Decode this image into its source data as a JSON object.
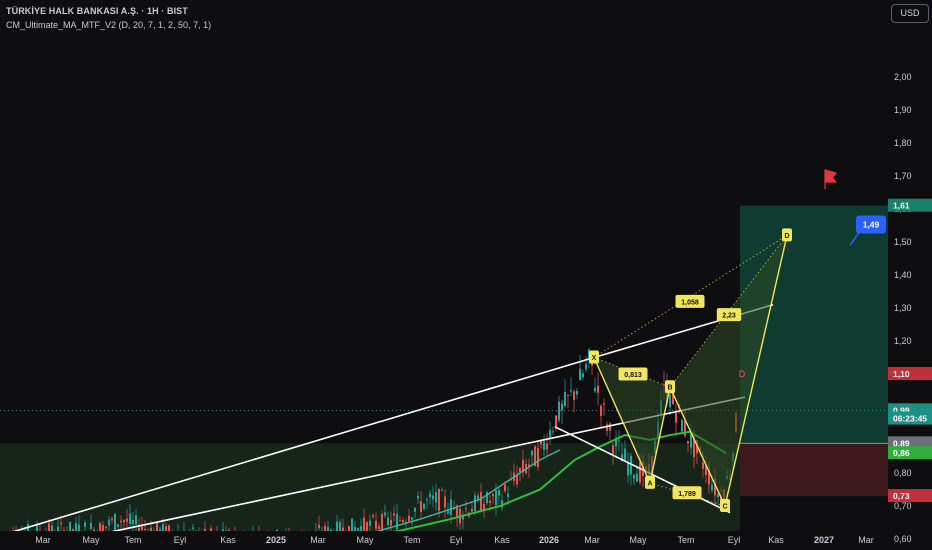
{
  "header": {
    "title": "TÜRKİYE HALK BANKASI A.Ş. · 1H · BIST",
    "indicator": "CM_Ultimate_MA_MTF_V2 (D, 20, 7, 1, 2, 50, 7, 1)",
    "currency": "USD"
  },
  "colors": {
    "background": "#0e0e10",
    "up": "#26a69a",
    "down": "#ef5350",
    "ma": "#2fbf3a",
    "pattern": "#f2e65a",
    "channel": "#ffffff",
    "target_zone": "#0f3b31",
    "stop_zone": "#3e1a1f"
  },
  "chart_data": {
    "type": "candlestick",
    "y_ticks": [
      "2,00",
      "1,90",
      "1,80",
      "1,70",
      "1,60",
      "1,50",
      "1,40",
      "1,30",
      "1,20",
      "1,10",
      "1,00",
      "0,90",
      "0,80",
      "0,70",
      "0,60"
    ],
    "ylim": [
      0.6,
      2.05
    ],
    "x_ticks": [
      "Mar",
      "May",
      "Tem",
      "Eyl",
      "Kas",
      "2025",
      "Mar",
      "May",
      "Tem",
      "Eyl",
      "Kas",
      "2026",
      "Mar",
      "May",
      "Tem",
      "Eyl",
      "Kas",
      "2027",
      "Mar"
    ],
    "price_tags": [
      {
        "label": "1,61",
        "value": 1.61,
        "color": "#1a7f6c"
      },
      {
        "label": "1,10",
        "value": 1.1,
        "color": "#c0303b"
      },
      {
        "label": "0,99",
        "value": 0.99,
        "color": "#1e8f84"
      },
      {
        "label": "06:23:45",
        "value": 0.965,
        "color": "#1e8f84"
      },
      {
        "label": "0,89",
        "value": 0.89,
        "color": "#6d6f77"
      },
      {
        "label": "0,86",
        "value": 0.86,
        "color": "#2fae3d"
      },
      {
        "label": "0,73",
        "value": 0.73,
        "color": "#c0303b"
      }
    ],
    "pattern_points": [
      {
        "label": "X",
        "value": 1.15
      },
      {
        "label": "A",
        "value": 0.77
      },
      {
        "label": "B",
        "value": 1.06
      },
      {
        "label": "C",
        "value": 0.7
      },
      {
        "label": "D",
        "value": 1.52
      }
    ],
    "pattern_ratios": [
      "0,813",
      "1,058",
      "1,789",
      "2,23"
    ],
    "target_label": "D",
    "target_callout": "1,49",
    "target_price": 1.61,
    "entry_price": 0.89,
    "stop_price": 0.73,
    "ma_last": 0.86,
    "last_price": 0.99
  }
}
